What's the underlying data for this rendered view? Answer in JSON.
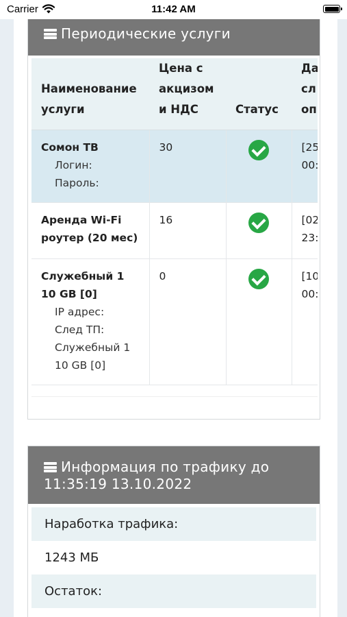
{
  "status_bar": {
    "carrier": "Carrier",
    "time": "11:42 AM"
  },
  "services_panel": {
    "title": "Периодические услуги",
    "header_icon": "server-icon",
    "columns": [
      [
        "Наименование",
        "услуги"
      ],
      [
        "Цена с",
        "акцизом",
        "и НДС"
      ],
      [
        "Статус"
      ],
      [
        "Да",
        "сл",
        "оп"
      ]
    ],
    "rows": [
      {
        "name": "Сомон ТВ",
        "details": [
          "Логин:",
          "Пароль:"
        ],
        "price": "30",
        "status_icon": "check-circle-icon",
        "date": [
          "[25",
          "00:"
        ]
      },
      {
        "name": "Аренда Wi-Fi роутер (20 мес)",
        "details": [],
        "price": "16",
        "status_icon": "check-circle-icon",
        "date": [
          "[02",
          "23:"
        ]
      },
      {
        "name": "Служебный 1 10 GB [0]",
        "details": [
          "IP адрес:",
          "След ТП:",
          "Служебный 1 10 GB [0]"
        ],
        "price": "0",
        "status_icon": "check-circle-icon",
        "date": [
          "[10",
          "00:"
        ]
      }
    ]
  },
  "traffic_panel": {
    "title_line1": "Информация по трафику до",
    "title_line2": "11:35:19 13.10.2022",
    "header_icon": "server-icon",
    "rows": [
      {
        "text": "Наработка трафика:"
      },
      {
        "text": "1243 МБ"
      },
      {
        "text": "Остаток:"
      }
    ]
  },
  "colors": {
    "header_bg": "#777777",
    "highlight_row": "#d8e9f1",
    "table_header_bg": "#e9f2f4",
    "status_ok": "#28a745"
  }
}
